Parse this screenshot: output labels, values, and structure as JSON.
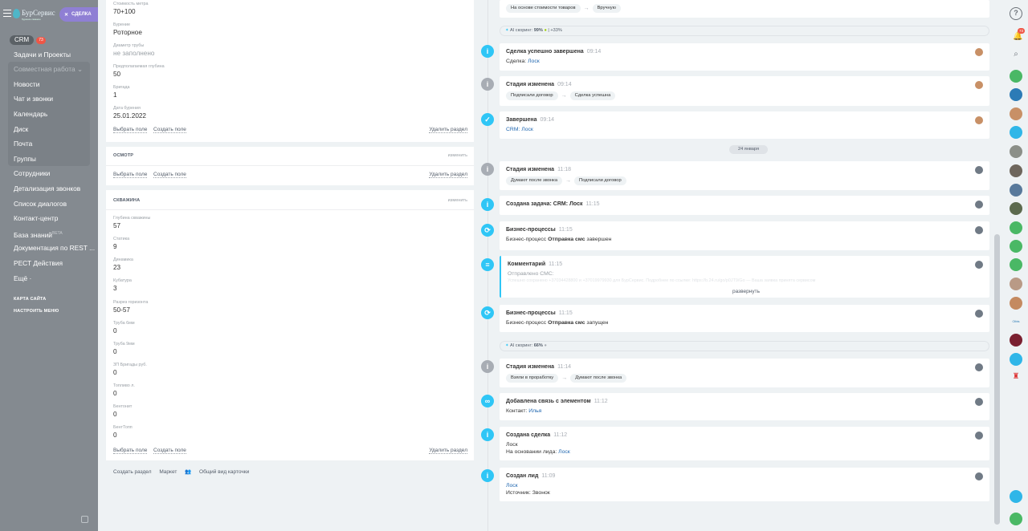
{
  "app": {
    "logo_text": "БурСервис",
    "logo_sub": "бурение скважин",
    "deal_button": "СДЕЛКА"
  },
  "sidebar": {
    "crm_label": "CRM",
    "crm_badge": "73",
    "items": [
      {
        "label": "Задачи и Проекты"
      },
      {
        "label": "Совместная работа ⌄"
      },
      {
        "label": "Новости"
      },
      {
        "label": "Чат и звонки"
      },
      {
        "label": "Календарь"
      },
      {
        "label": "Диск"
      },
      {
        "label": "Почта"
      },
      {
        "label": "Группы"
      },
      {
        "label": "Сотрудники"
      },
      {
        "label": "Детализация звонков"
      },
      {
        "label": "Список диалогов"
      },
      {
        "label": "Контакт-центр"
      },
      {
        "label": "База знаний"
      },
      {
        "label": "Документация по REST ..."
      },
      {
        "label": "РЕСТ Действия"
      },
      {
        "label": "Ещё ·"
      }
    ],
    "kb_super": "BETA",
    "site_map": "КАРТА САЙТА",
    "configure_menu": "НАСТРОИТЬ МЕНЮ"
  },
  "details": {
    "section1": {
      "fields": [
        {
          "label": "Стоимость метра",
          "value": "70+100"
        },
        {
          "label": "Бурение",
          "value": "Роторное"
        },
        {
          "label": "Диаметр трубы",
          "value": "не заполнено"
        },
        {
          "label": "Предполагаемая глубина",
          "value": "50"
        },
        {
          "label": "Бригада",
          "value": "1"
        },
        {
          "label": "Дата бурения",
          "value": "25.01.2022"
        }
      ],
      "select_field": "Выбрать поле",
      "create_field": "Создать поле",
      "delete_section": "Удалить раздел"
    },
    "section2": {
      "title": "ОСМОТР",
      "edit": "изменить",
      "select_field": "Выбрать поле",
      "create_field": "Создать поле",
      "delete_section": "Удалить раздел"
    },
    "section3": {
      "title": "СКВАЖИНА",
      "edit": "изменить",
      "fields": [
        {
          "label": "Глубина скважины",
          "value": "57"
        },
        {
          "label": "Статика",
          "value": "9"
        },
        {
          "label": "Динамика",
          "value": "23"
        },
        {
          "label": "Кубатура",
          "value": "3"
        },
        {
          "label": "Разрез горизонта",
          "value": "50-57"
        },
        {
          "label": "Труба 6мм",
          "value": "0"
        },
        {
          "label": "Труба 9мм",
          "value": "0"
        },
        {
          "label": "ЗП Бригады руб.",
          "value": "0"
        },
        {
          "label": "Топливо л.",
          "value": "0"
        },
        {
          "label": "Бентонит",
          "value": "0"
        },
        {
          "label": "БентТопп",
          "value": "0"
        }
      ],
      "select_field": "Выбрать поле",
      "create_field": "Создать поле",
      "delete_section": "Удалить раздел"
    },
    "footer": {
      "create_section": "Создать раздел",
      "market": "Маркет",
      "card_view": "Общий вид карточки"
    }
  },
  "timeline": {
    "top_chip_from": "На основе стоимости товаров",
    "top_chip_to": "Вручную",
    "scoring1": {
      "label": "AI скоринг:",
      "value": "99%",
      "delta": "+33%"
    },
    "events": [
      {
        "title": "Сделка успешно завершена",
        "time": "09:14",
        "prefix": "Сделка:",
        "link": "Лоск"
      },
      {
        "title": "Стадия изменена",
        "time": "09:14",
        "from": "Подписали договор",
        "to": "Сделка успешна"
      },
      {
        "title": "Завершена",
        "time": "09:14",
        "prefix": "CRM:",
        "link": "Лоск"
      },
      {
        "title": "Стадия изменена",
        "time": "11:18",
        "from": "Думают после звонка",
        "to": "Подписали договор"
      },
      {
        "title": "Создана задача: CRM: Лоск",
        "time": "11:15"
      },
      {
        "title": "Бизнес-процессы",
        "time": "11:15",
        "prefix": "Бизнес-процесс",
        "bold": "Отправка смс",
        "suffix": "завершен"
      },
      {
        "title": "Комментарий",
        "time": "11:15",
        "text": "Отправлено СМС:",
        "faded": "Успешно сохранено +37034428800 и +37019979930 для БурСервис. Подробнее по ссылке: https://b.24.ru/go/p0JT9/Go — Ваша заявка принята сервисом",
        "expand": "развернуть"
      },
      {
        "title": "Бизнес-процессы",
        "time": "11:15",
        "prefix": "Бизнес-процесс",
        "bold": "Отправка смс",
        "suffix": "запущен"
      },
      {
        "title": "Стадия изменена",
        "time": "11:14",
        "from": "Взяли в проработку",
        "to": "Думают после звонка"
      },
      {
        "title": "Добавлена связь с элементом",
        "time": "11:12",
        "prefix": "Контакт:",
        "link": "Илья"
      },
      {
        "title": "Создана сделка",
        "time": "11:12",
        "line1": "Лоск",
        "prefix": "На основании лида:",
        "link": "Лоск"
      },
      {
        "title": "Создан лид",
        "time": "11:09",
        "line1": "Лоск",
        "source": "Источник: Звонок"
      }
    ],
    "date_separator": "24 января",
    "scoring2": {
      "label": "AI скоринг:",
      "value": "66%"
    }
  },
  "rightbar": {
    "help": "?",
    "notif_badge": "73"
  },
  "colors": {
    "accent_blue": "#2fc6f6",
    "sidebar_bg": "#848a90",
    "deal_btn": "#8f7fd4",
    "badge_red": "#ef5646"
  }
}
